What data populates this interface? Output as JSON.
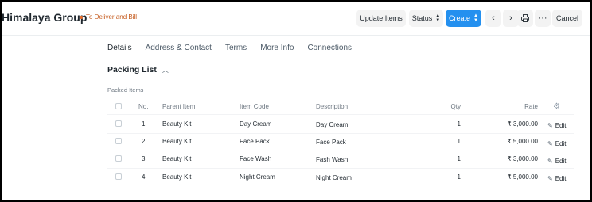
{
  "header": {
    "title": "Himalaya Group",
    "status": "To Deliver and Bill",
    "buttons": {
      "update_items": "Update Items",
      "status": "Status",
      "create": "Create",
      "cancel": "Cancel"
    },
    "icons": {
      "prev": "chevron-left-icon",
      "next": "chevron-right-icon",
      "print": "printer-icon",
      "more": "more-horizontal-icon"
    }
  },
  "tabs": [
    {
      "label": "Details",
      "active": true
    },
    {
      "label": "Address & Contact",
      "active": false
    },
    {
      "label": "Terms",
      "active": false
    },
    {
      "label": "More Info",
      "active": false
    },
    {
      "label": "Connections",
      "active": false
    }
  ],
  "section": {
    "title": "Packing List",
    "expanded": true
  },
  "packed_items": {
    "label": "Packed Items",
    "columns": {
      "no": "No.",
      "parent_item": "Parent Item",
      "item_code": "Item Code",
      "description": "Description",
      "qty": "Qty",
      "rate": "Rate"
    },
    "edit_label": "Edit",
    "rows": [
      {
        "no": "1",
        "parent_item": "Beauty Kit",
        "item_code": "Day Cream",
        "description": "Day Cream",
        "qty": "1",
        "rate": "₹ 3,000.00"
      },
      {
        "no": "2",
        "parent_item": "Beauty Kit",
        "item_code": "Face Pack",
        "description": "Face Pack",
        "qty": "1",
        "rate": "₹ 5,000.00"
      },
      {
        "no": "3",
        "parent_item": "Beauty Kit",
        "item_code": "Face Wash",
        "description": "Fash Wash",
        "qty": "1",
        "rate": "₹ 3,000.00"
      },
      {
        "no": "4",
        "parent_item": "Beauty Kit",
        "item_code": "Night Cream",
        "description": "Night Cream",
        "qty": "1",
        "rate": "₹ 5,000.00"
      }
    ]
  },
  "colors": {
    "primary": "#2490ef",
    "status": "#e86c2a"
  }
}
